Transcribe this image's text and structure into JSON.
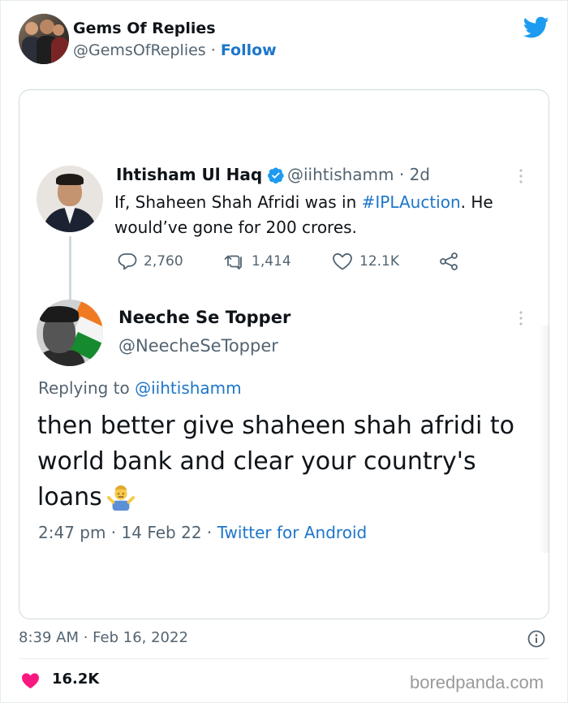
{
  "embed": {
    "account_name": "Gems Of Replies",
    "account_handle": "@GemsOfReplies",
    "separator": " · ",
    "follow_label": "Follow",
    "brand_icon": "twitter-bird-icon",
    "brand_color": "#1d9bf0"
  },
  "original_tweet": {
    "author_name": "Ihtisham Ul Haq",
    "verified_icon": "verified-badge-icon",
    "handle_and_age": "@iihtishamm · 2d",
    "text_before": "If, Shaheen Shah Afridi was in ",
    "hashtag": "#IPLAuction",
    "text_after": ". He would’ve gone for 200 crores.",
    "reply_count": "2,760",
    "retweet_count": "1,414",
    "like_count": "12.1K",
    "more_icon": "more-vertical-icon"
  },
  "reply_tweet": {
    "author_name": "Neeche Se Topper",
    "handle": "@NeecheSeTopper",
    "replying_prefix": "Replying to ",
    "replying_mention": "@iihtishamm",
    "text": "then better give shaheen shah afridi to world bank and clear your country's loans",
    "emoji_icon": "man-shrugging-emoji-icon",
    "time_date": "2:47 pm · 14 Feb 22 · ",
    "source": "Twitter for Android",
    "more_icon": "more-vertical-icon"
  },
  "footer": {
    "timestamp": "8:39 AM · Feb 16, 2022",
    "like_count": "16.2K",
    "watermark": "boredpanda.com",
    "like_color": "#f91880",
    "link_color": "#1d76c9"
  }
}
